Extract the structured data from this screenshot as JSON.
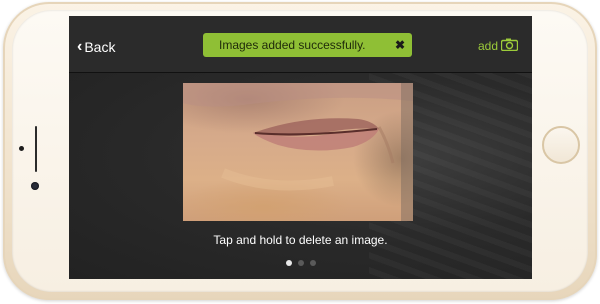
{
  "nav": {
    "back_label": "Back",
    "toast_message": "Images added successfully.",
    "toast_close_symbol": "✖",
    "add_label": "add",
    "add_icon": "camera-icon",
    "accent_color": "#9ccb3a",
    "toast_color": "#8fbf35"
  },
  "gallery": {
    "hint": "Tap and hold to delete an image.",
    "page_count": 3,
    "active_page": 1
  },
  "device": {
    "color": "gold"
  }
}
